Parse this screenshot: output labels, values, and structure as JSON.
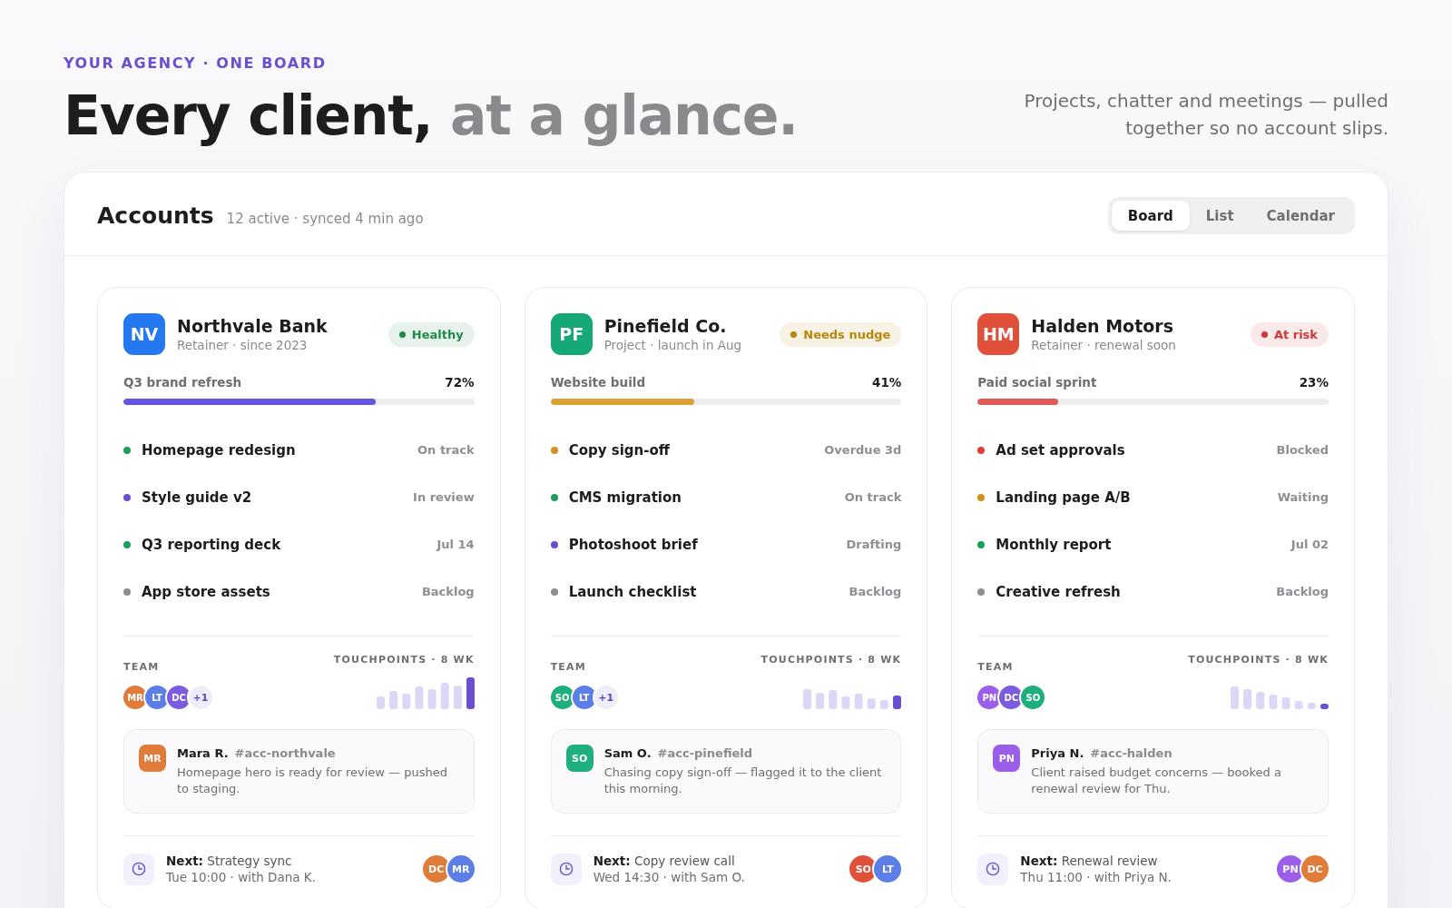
{
  "header": {
    "eyebrow": "YOUR AGENCY · ONE BOARD",
    "headline": {
      "lead": "Every client,",
      "muted": "at a glance."
    },
    "tagline": "Projects, chatter and meetings — pulled together so no account slips."
  },
  "panel": {
    "title": "Accounts",
    "meta": "12 active · synced 4 min ago",
    "views": [
      {
        "label": "Board",
        "selected": true
      },
      {
        "label": "List",
        "selected": false
      },
      {
        "label": "Calendar",
        "selected": false
      }
    ]
  },
  "accounts": [
    {
      "logo": {
        "initials": "NV",
        "color": "#2478f0"
      },
      "name": "Northvale Bank",
      "subtitle": "Retainer · since 2023",
      "status": {
        "label": "Healthy",
        "color": "#1e8a4a"
      },
      "progress": {
        "label": "Q3 brand refresh",
        "value": "72%",
        "level": 0.72,
        "color": "#6256e0"
      },
      "tasks": [
        {
          "name": "Homepage redesign",
          "status": "On track",
          "color": "#1e9e5a"
        },
        {
          "name": "Style guide v2",
          "status": "In review",
          "color": "#6a4fd0"
        },
        {
          "name": "Q3 reporting deck",
          "status": "Jul 14",
          "color": "#1e9e5a"
        },
        {
          "name": "App store assets",
          "status": "Backlog",
          "color": "#8e8e93"
        }
      ],
      "team_label": "TEAM",
      "team": [
        {
          "initials": "MR",
          "color": "#e07b39"
        },
        {
          "initials": "LT",
          "color": "#5b7fe6"
        },
        {
          "initials": "DC",
          "color": "#7b5ce0"
        }
      ],
      "team_more": "+1",
      "touchpoints": {
        "label": "TOUCHPOINTS · 8 WK",
        "kind": "rising"
      },
      "message": {
        "initials": "MR",
        "color": "#e07b39",
        "author": "Mara R.",
        "channel": "#acc-northvale",
        "text": "Homepage hero is ready for review — pushed to staging."
      },
      "next": {
        "title": "**Next:** Strategy sync",
        "detail": "Tue 10:00 · with Dana K.",
        "attendees": [
          {
            "initials": "DC",
            "color": "#e07b39"
          },
          {
            "initials": "MR",
            "color": "#5b7fe6"
          }
        ]
      }
    },
    {
      "logo": {
        "initials": "PF",
        "color": "#17a877"
      },
      "name": "Pinefield Co.",
      "subtitle": "Project · launch in Aug",
      "status": {
        "label": "Needs nudge",
        "color": "#b8860b"
      },
      "progress": {
        "label": "Website build",
        "value": "41%",
        "level": 0.41,
        "color": "#dca035"
      },
      "tasks": [
        {
          "name": "Copy sign-off",
          "status": "Overdue 3d",
          "color": "#d4901a"
        },
        {
          "name": "CMS migration",
          "status": "On track",
          "color": "#1e9e5a"
        },
        {
          "name": "Photoshoot brief",
          "status": "Drafting",
          "color": "#6a4fd0"
        },
        {
          "name": "Launch checklist",
          "status": "Backlog",
          "color": "#8e8e93"
        }
      ],
      "team_label": "TEAM",
      "team": [
        {
          "initials": "SO",
          "color": "#1fae7e"
        },
        {
          "initials": "LT",
          "color": "#5b7fe6"
        }
      ],
      "team_more": "+1",
      "touchpoints": {
        "label": "TOUCHPOINTS · 8 WK",
        "kind": "uneven"
      },
      "message": {
        "initials": "SO",
        "color": "#1fae7e",
        "author": "Sam O.",
        "channel": "#acc-pinefield",
        "text": "Chasing copy sign-off — flagged it to the client this morning."
      },
      "next": {
        "title": "**Next:** Copy review call",
        "detail": "Wed 14:30 · with Sam O.",
        "attendees": [
          {
            "initials": "SO",
            "color": "#e0503a"
          },
          {
            "initials": "LT",
            "color": "#5b7fe6"
          }
        ]
      }
    },
    {
      "logo": {
        "initials": "HM",
        "color": "#e0503a"
      },
      "name": "Halden Motors",
      "subtitle": "Retainer · renewal soon",
      "status": {
        "label": "At risk",
        "color": "#d0363a"
      },
      "progress": {
        "label": "Paid social sprint",
        "value": "23%",
        "level": 0.23,
        "color": "#e05a55"
      },
      "tasks": [
        {
          "name": "Ad set approvals",
          "status": "Blocked",
          "color": "#d9403f"
        },
        {
          "name": "Landing page A/B",
          "status": "Waiting",
          "color": "#d4901a"
        },
        {
          "name": "Monthly report",
          "status": "Jul 02",
          "color": "#1e9e5a"
        },
        {
          "name": "Creative refresh",
          "status": "Backlog",
          "color": "#8e8e93"
        }
      ],
      "team_label": "TEAM",
      "team": [
        {
          "initials": "PN",
          "color": "#9b5ee8"
        },
        {
          "initials": "DC",
          "color": "#7b5ce0"
        },
        {
          "initials": "SO",
          "color": "#1fae7e"
        }
      ],
      "touchpoints": {
        "label": "TOUCHPOINTS · 8 WK",
        "kind": "falling"
      },
      "message": {
        "initials": "PN",
        "color": "#9b5ee8",
        "author": "Priya N.",
        "channel": "#acc-halden",
        "text": "Client raised budget concerns — booked a renewal review for Thu."
      },
      "next": {
        "title": "**Next:** Renewal review",
        "detail": "Thu 11:00 · with Priya N.",
        "attendees": [
          {
            "initials": "PN",
            "color": "#9b5ee8"
          },
          {
            "initials": "DC",
            "color": "#e07b39"
          }
        ]
      }
    }
  ]
}
